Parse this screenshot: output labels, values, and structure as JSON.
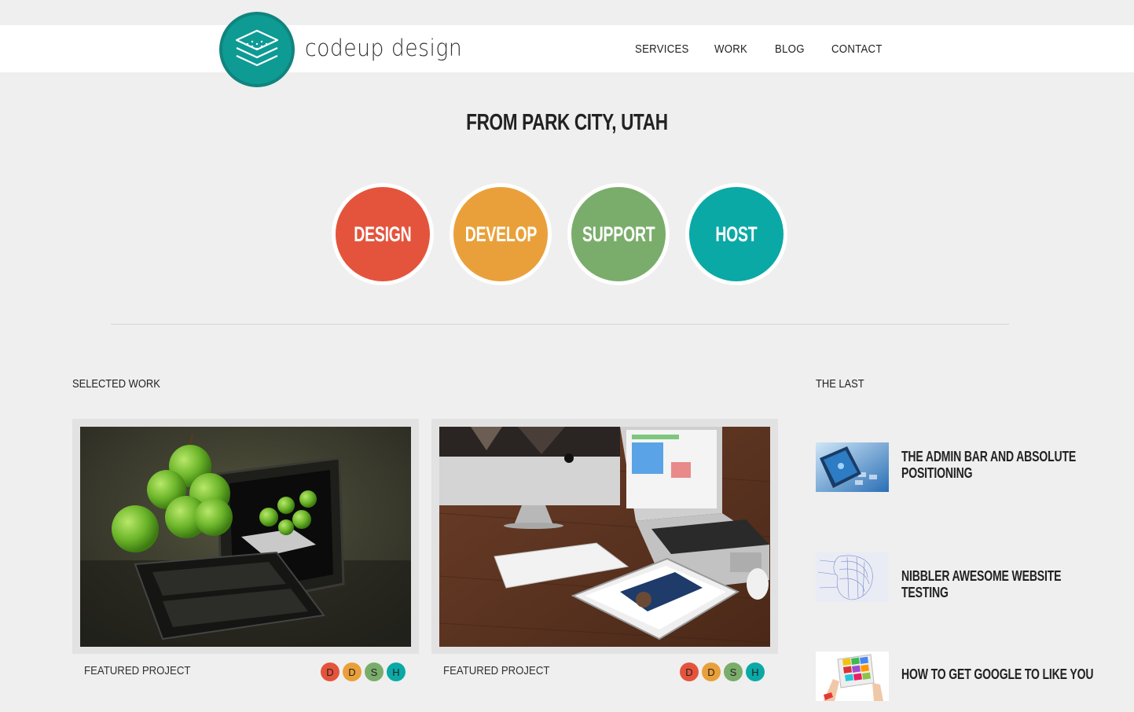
{
  "brand": {
    "name": "codeup design",
    "logo_icon": "layers-icon",
    "logo_color": "#0d9b94"
  },
  "nav": {
    "items": [
      "SERVICES",
      "WORK",
      "BLOG",
      "CONTACT"
    ]
  },
  "hero": {
    "tagline": "FROM PARK CITY, UTAH",
    "services": [
      {
        "label": "DESIGN",
        "color": "#e4543c"
      },
      {
        "label": "DEVELOP",
        "color": "#eaa03a"
      },
      {
        "label": "SUPPORT",
        "color": "#7aad6b"
      },
      {
        "label": "HOST",
        "color": "#0aa9a6"
      }
    ]
  },
  "work": {
    "heading": "SELECTED WORK",
    "projects": [
      {
        "label": "FEATURED PROJECT",
        "image": "tablet-keyboard-apples-photo",
        "badges": [
          "D",
          "D",
          "S",
          "H"
        ]
      },
      {
        "label": "FEATURED PROJECT",
        "image": "imac-macbook-ipad-desk-photo",
        "badges": [
          "D",
          "D",
          "S",
          "H"
        ]
      }
    ]
  },
  "blog": {
    "heading": "THE LAST",
    "posts": [
      {
        "title": "THE ADMIN BAR AND ABSOLUTE POSITIONING",
        "image": "phone-social-keyboard-thumb"
      },
      {
        "title": "NIBBLER AWESOME WEBSITE TESTING",
        "image": "wireframe-face-thumb"
      },
      {
        "title": "HOW TO GET GOOGLE TO LIKE YOU",
        "image": "hands-tablet-color-thumb"
      }
    ]
  }
}
